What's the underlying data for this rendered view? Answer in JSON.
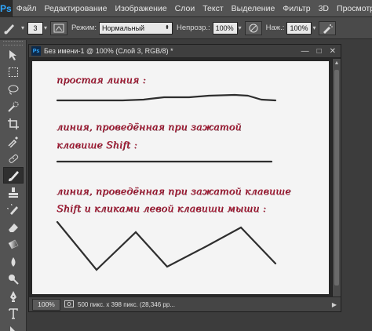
{
  "menubar": {
    "logo": "Ps",
    "items": [
      "Файл",
      "Редактирование",
      "Изображение",
      "Слои",
      "Текст",
      "Выделение",
      "Фильтр",
      "3D",
      "Просмотр"
    ]
  },
  "options": {
    "brush_size": "3",
    "mode_label": "Режим:",
    "mode_value": "Нормальный",
    "opacity_label": "Непрозр.:",
    "opacity_value": "100%",
    "pressure_label": "Наж.:",
    "pressure_value": "100%"
  },
  "document": {
    "ps_badge": "Ps",
    "title": "Без имени-1 @ 100% (Слой 3, RGB/8) *",
    "minimize": "—",
    "maximize": "□",
    "close": "✕"
  },
  "canvas_text": {
    "line1": "простая линия :",
    "line2a": "линия, проведённая при зажатой",
    "line2b": "клавише Shift :",
    "line3a": "линия, проведённая при зажатой клавише",
    "line3b": "Shift  и кликами левой клавиши мыши :"
  },
  "status": {
    "zoom": "100%",
    "info": "500 пикс. x 398 пикс. (28,346 рр..."
  },
  "tools": [
    "move-tool",
    "marquee-tool",
    "lasso-tool",
    "quick-select-tool",
    "crop-tool",
    "eyedropper-tool",
    "healing-brush-tool",
    "brush-tool",
    "clone-stamp-tool",
    "history-brush-tool",
    "eraser-tool",
    "gradient-tool",
    "blur-tool",
    "dodge-tool",
    "pen-tool",
    "type-tool",
    "path-select-tool"
  ],
  "colors": {
    "handwriting": "#b0203a",
    "canvas": "#f4f4f4",
    "stroke": "#2e2e2e",
    "ps_blue": "#31a8ff"
  }
}
